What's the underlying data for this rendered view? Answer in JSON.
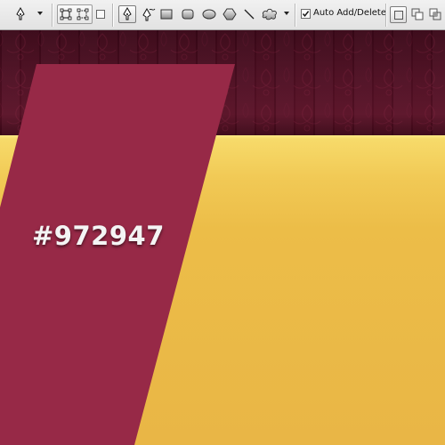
{
  "options_bar": {
    "icons": {
      "pen_tool_preset": "pen-icon",
      "shape_layers": "shape-layers-icon",
      "paths": "paths-icon",
      "fill_pixels": "fill-pixels-icon",
      "pen": "pen-icon",
      "freeform_pen": "freeform-pen-icon",
      "rectangle": "rectangle-icon",
      "rounded_rectangle": "rounded-rectangle-icon",
      "ellipse": "ellipse-icon",
      "polygon": "polygon-icon",
      "line": "line-icon",
      "custom_shape": "custom-shape-icon",
      "add_to_path": "add-to-path-icon",
      "subtract_from_path": "subtract-from-path-icon",
      "intersect_path": "intersect-path-icon"
    },
    "auto_add_delete": {
      "label": "Auto Add/Delete",
      "checked": true
    }
  },
  "canvas": {
    "hex_label": "#972947",
    "colors": {
      "stripe": "#972947",
      "header": "#4e0e22",
      "yellow": "#ecbd48"
    }
  }
}
